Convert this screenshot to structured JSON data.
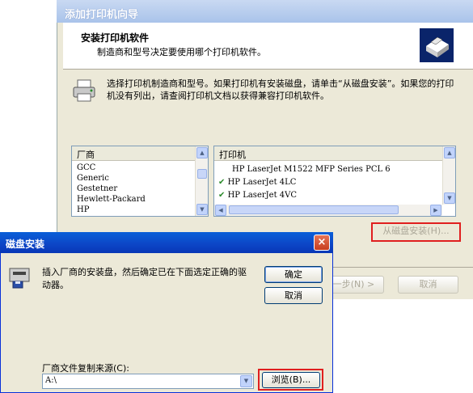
{
  "wizard": {
    "title": "添加打印机向导",
    "header_title": "安装打印机软件",
    "header_subtitle": "制造商和型号决定要使用哪个打印机软件。",
    "instruction": "选择打印机制造商和型号。如果打印机有安装磁盘，请单击“从磁盘安装”。如果您的打印机没有列出，请查阅打印机文档以获得兼容打印机软件。",
    "manufacturer_header": "厂商",
    "manufacturers": [
      "GCC",
      "Generic",
      "Gestetner",
      "Hewlett-Packard",
      "HP"
    ],
    "printer_header": "打印机",
    "printers": [
      {
        "name": "HP LaserJet M1522 MFP Series PCL 6",
        "checked": false
      },
      {
        "name": "HP LaserJet 4LC",
        "checked": true
      },
      {
        "name": "HP LaserJet 4VC",
        "checked": true
      }
    ],
    "have_disk_button": "从磁盘安装(H)...",
    "next_button": "一步(N) >",
    "cancel_button": "取消"
  },
  "dialog": {
    "title": "磁盘安装",
    "close_label": "×",
    "message": "插入厂商的安装盘，然后确定已在下面选定正确的驱动器。",
    "ok_button": "确定",
    "cancel_button": "取消",
    "source_label": "厂商文件复制来源(C):",
    "source_value": "A:\\",
    "browse_button": "浏览(B)..."
  },
  "colors": {
    "accent": "#0a5fd8",
    "highlight_red": "#e01f1f",
    "face": "#ece9d8"
  }
}
